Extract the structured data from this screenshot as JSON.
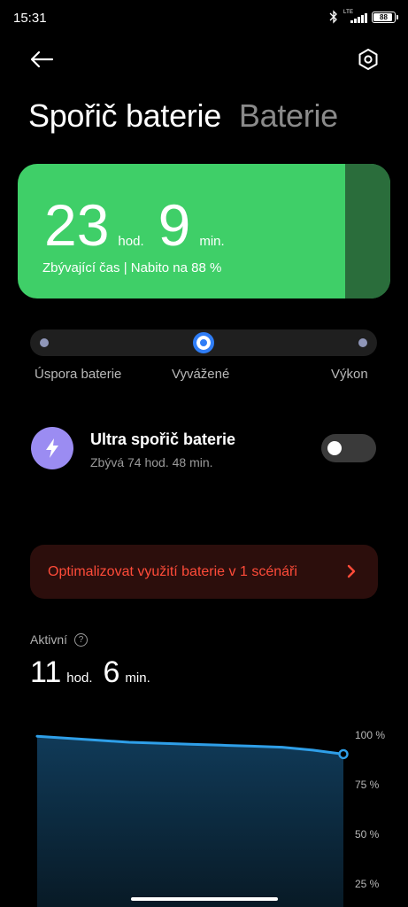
{
  "status_bar": {
    "time": "15:31",
    "network": "LTE",
    "battery_level": "88"
  },
  "toolbar": {
    "back_icon": "arrow-left-icon",
    "settings_icon": "gear-hexagon-icon"
  },
  "tabs": [
    {
      "label": "Spořič baterie",
      "active": true
    },
    {
      "label": "Baterie",
      "active": false
    }
  ],
  "hero": {
    "hours": "23",
    "hours_unit": "hod.",
    "minutes": "9",
    "minutes_unit": "min.",
    "subtitle": "Zbývající čas | Nabito na 88 %",
    "charge_fraction": 0.88,
    "color_fill": "#3fcf68",
    "color_remaining": "#2a6d3b"
  },
  "modes": {
    "options": [
      "Úspora baterie",
      "Vyvážené",
      "Výkon"
    ],
    "selected_index": 1,
    "accent": "#2f7df6"
  },
  "ultra_saver": {
    "icon": "lightning-bolt-icon",
    "title": "Ultra spořič baterie",
    "subtitle": "Zbývá 74 hod. 48 min.",
    "enabled": false,
    "icon_color": "#9b8cf2"
  },
  "optimize": {
    "text": "Optimalizovat využití baterie v 1 scénáři",
    "color": "#ff4b39"
  },
  "active": {
    "label": "Aktivní",
    "hours": "11",
    "hours_unit": "hod.",
    "minutes": "6",
    "minutes_unit": "min."
  },
  "chart_data": {
    "type": "area",
    "x": [
      0,
      1,
      2,
      3,
      4,
      5,
      6,
      7,
      8,
      9,
      10
    ],
    "values": [
      99,
      98,
      97,
      96,
      95.5,
      95,
      94.5,
      94,
      93.5,
      92,
      90
    ],
    "y_ticks": [
      "100 %",
      "75 %",
      "50 %",
      "25 %"
    ],
    "ylim": [
      0,
      100
    ],
    "line_color": "#2f9fe8",
    "fill_top": "#103a58",
    "fill_bottom": "#081a26"
  }
}
